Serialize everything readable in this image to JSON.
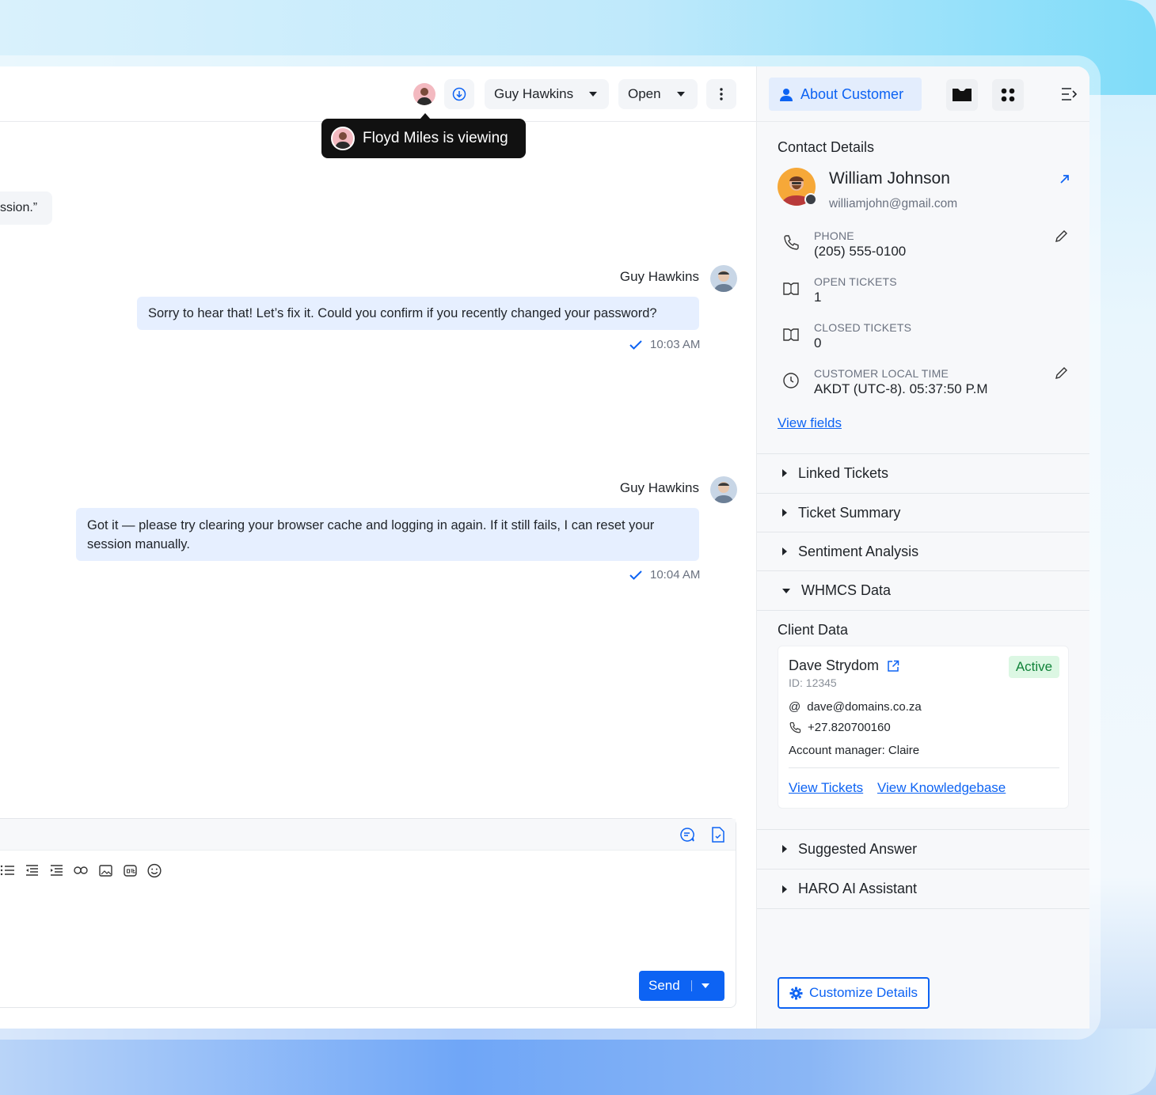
{
  "header": {
    "assignee": "Guy Hawkins",
    "status": "Open"
  },
  "viewer": {
    "tooltip": "Floyd Miles is viewing"
  },
  "conversation": {
    "fragment": "ssion.”",
    "messages": [
      {
        "sender": "Guy Hawkins",
        "text": "Sorry to hear that! Let’s fix it. Could you confirm if you recently changed your password?",
        "time": "10:03 AM"
      },
      {
        "sender": "Guy Hawkins",
        "text": "Got it — please try clearing your browser cache and logging in again. If it still fails, I can reset your session manually.",
        "time": "10:04 AM"
      }
    ]
  },
  "composer": {
    "send_label": "Send"
  },
  "panel": {
    "about_tab": "About Customer",
    "contact_title": "Contact Details",
    "customer": {
      "name": "William Johnson",
      "email": "williamjohn@gmail.com"
    },
    "fields": [
      {
        "label": "PHONE",
        "value": "(205) 555-0100"
      },
      {
        "label": "OPEN TICKETS",
        "value": "1"
      },
      {
        "label": "CLOSED TICKETS",
        "value": "0"
      },
      {
        "label": "CUSTOMER LOCAL TIME",
        "value": "AKDT (UTC-8). 05:37:50 P.M"
      }
    ],
    "view_fields": "View fields",
    "accordions": [
      "Linked Tickets",
      "Ticket Summary",
      "Sentiment Analysis",
      "WHMCS Data"
    ],
    "client_title": "Client Data",
    "client": {
      "name": "Dave Strydom",
      "status": "Active",
      "id": "ID: 12345",
      "email": "dave@domains.co.za",
      "phone": "+27.820700160",
      "manager": "Account manager: Claire",
      "view_tickets": "View Tickets",
      "view_kb": "View Knowledgebase"
    },
    "accordions_bottom": [
      "Suggested Answer",
      "HARO AI Assistant"
    ],
    "customize": "Customize Details"
  },
  "colors": {
    "accent": "#0d63f3",
    "bubble": "#e6efff",
    "active_bg": "#dcf7e3",
    "active_text": "#12833a"
  }
}
